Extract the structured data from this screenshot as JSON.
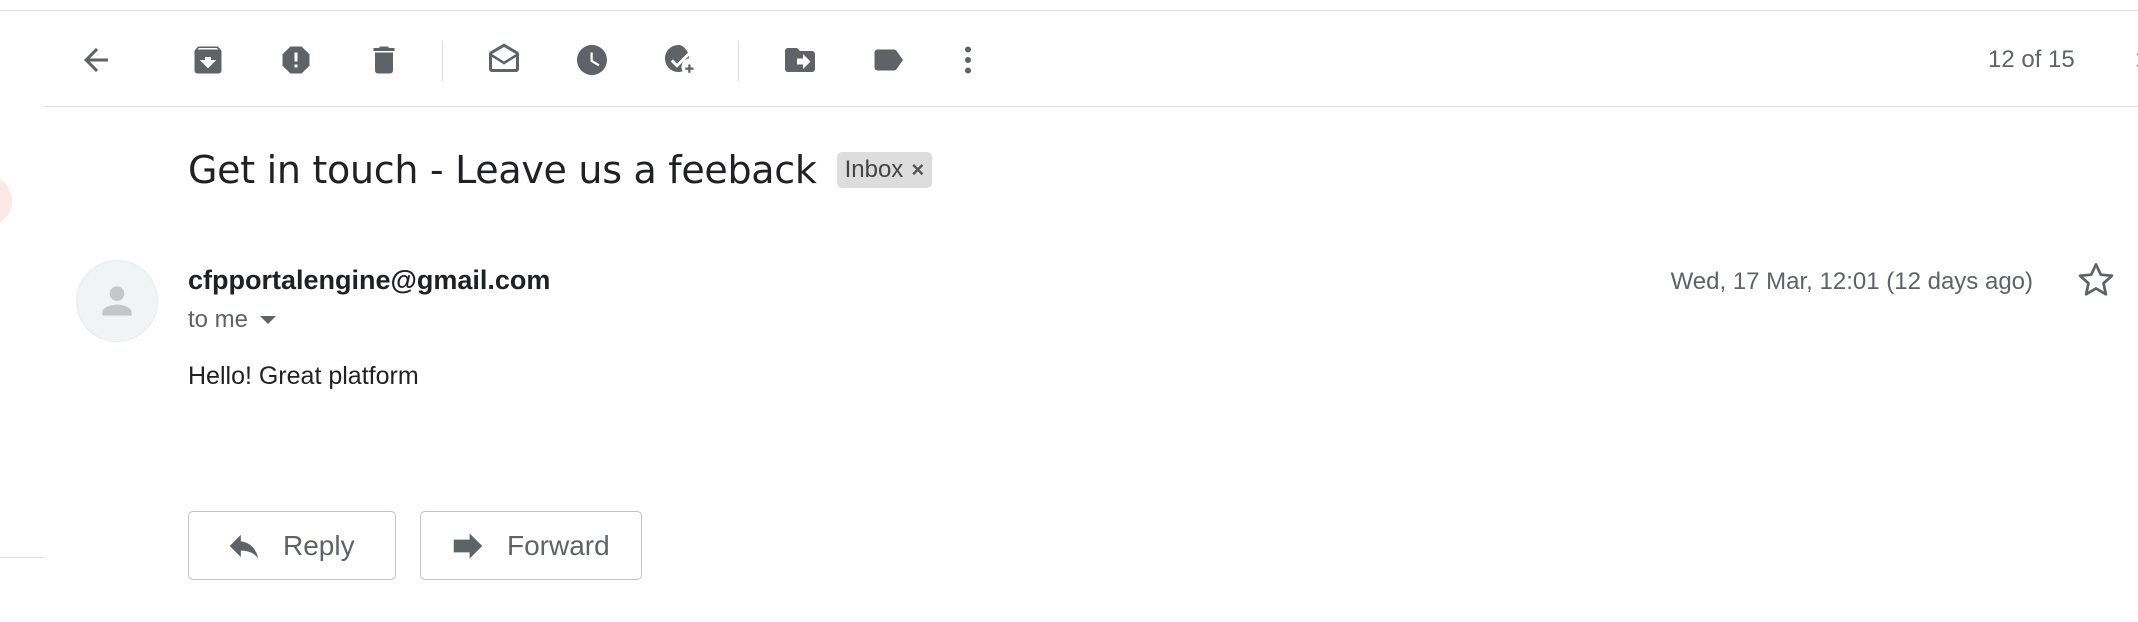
{
  "toolbar": {
    "icons": [
      "back-arrow-icon",
      "archive-icon",
      "report-spam-icon",
      "delete-icon",
      "mark-unread-icon",
      "snooze-icon",
      "add-to-tasks-icon",
      "move-to-icon",
      "labels-icon",
      "more-icon",
      "next-icon"
    ],
    "pager_text": "12 of 15"
  },
  "email": {
    "subject": "Get in touch - Leave us a feeback",
    "label": "Inbox",
    "label_remove": "×",
    "sender": "cfpportalengine@gmail.com",
    "recipient_text": "to me",
    "date": "Wed, 17 Mar, 12:01 (12 days ago)",
    "body": "Hello! Great platform"
  },
  "actions": {
    "reply_label": "Reply",
    "forward_label": "Forward"
  },
  "colors": {
    "icon_gray": "#5f6368",
    "chip_bg": "#dddddd",
    "divider": "#e0e0e0"
  }
}
